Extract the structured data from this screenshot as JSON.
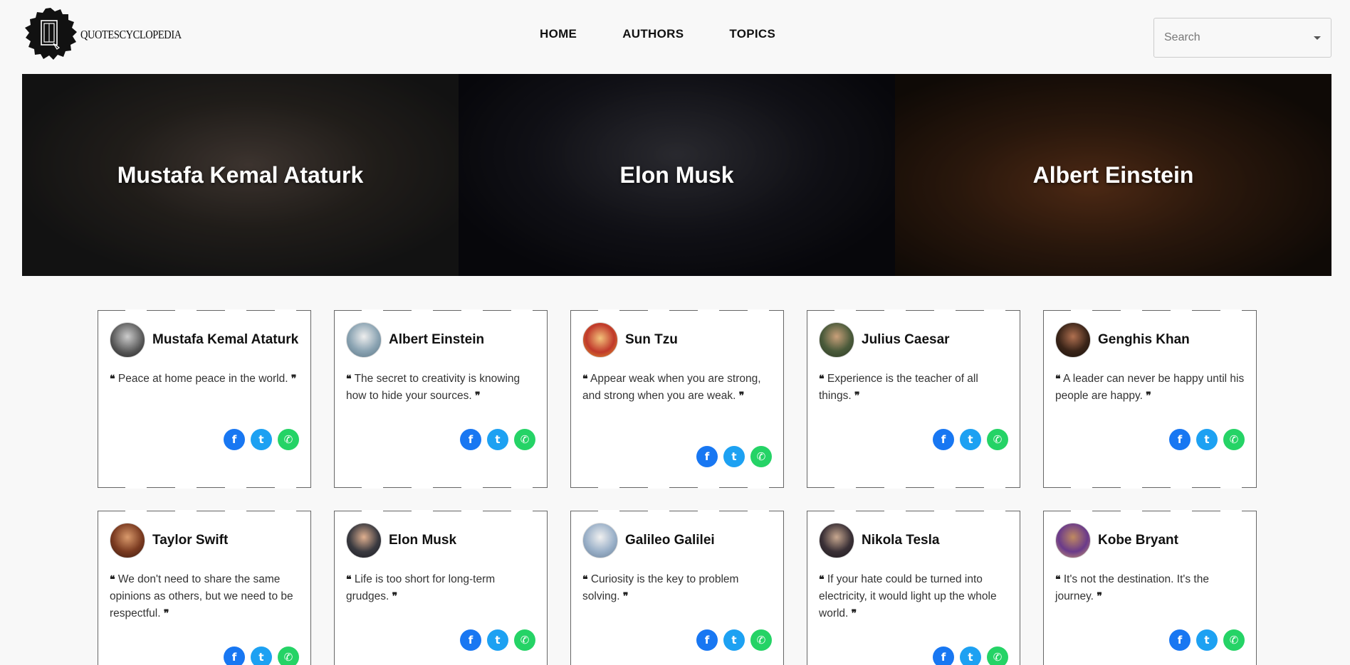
{
  "brand": {
    "name": "QUOTESCYCLOPEDIA"
  },
  "nav": [
    {
      "label": "HOME"
    },
    {
      "label": "AUTHORS"
    },
    {
      "label": "TOPICS"
    }
  ],
  "search": {
    "placeholder": "Search"
  },
  "hero": [
    {
      "name": "Mustafa Kemal Ataturk"
    },
    {
      "name": "Elon Musk"
    },
    {
      "name": "Albert Einstein"
    }
  ],
  "quotes": [
    {
      "author": "Mustafa Kemal Ataturk",
      "quote": "Peace at home peace in the world."
    },
    {
      "author": "Albert Einstein",
      "quote": "The secret to creativity is knowing how to hide your sources."
    },
    {
      "author": "Sun Tzu",
      "quote": "Appear weak when you are strong, and strong when you are weak."
    },
    {
      "author": "Julius Caesar",
      "quote": "Experience is the teacher of all things."
    },
    {
      "author": "Genghis Khan",
      "quote": "A leader can never be happy until his people are happy."
    },
    {
      "author": "Taylor Swift",
      "quote": "We don't need to share the same opinions as others, but we need to be respectful."
    },
    {
      "author": "Elon Musk",
      "quote": "Life is too short for long-term grudges."
    },
    {
      "author": "Galileo Galilei",
      "quote": "Curiosity is the key to problem solving."
    },
    {
      "author": "Nikola Tesla",
      "quote": "If your hate could be turned into electricity, it would light up the whole world."
    },
    {
      "author": "Kobe Bryant",
      "quote": "It's not the destination. It's the journey."
    }
  ],
  "colors": {
    "facebook": "#1877f2",
    "twitter": "#1da1f2",
    "whatsapp": "#25d366"
  }
}
